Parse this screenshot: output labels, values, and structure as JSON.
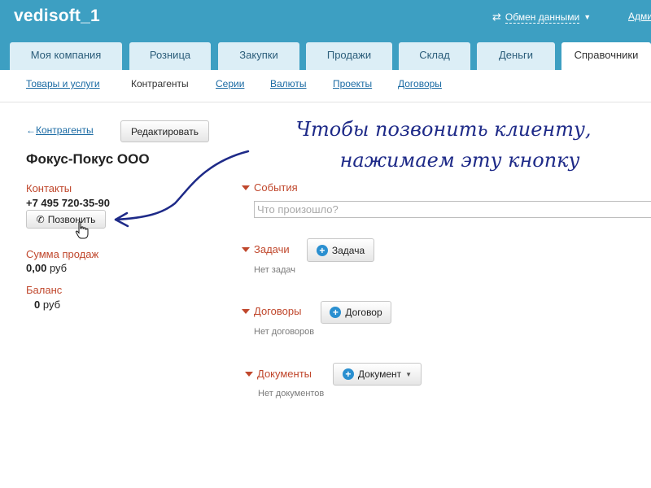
{
  "app": {
    "logo": "vedisoft_1",
    "exchange_label": "Обмен данными",
    "admin_label": "Адми"
  },
  "tabs": [
    {
      "label": "Моя компания"
    },
    {
      "label": "Розница"
    },
    {
      "label": "Закупки"
    },
    {
      "label": "Продажи"
    },
    {
      "label": "Склад"
    },
    {
      "label": "Деньги"
    },
    {
      "label": "Справочники",
      "active": true
    }
  ],
  "subnav": [
    {
      "label": "Товары и услуги"
    },
    {
      "label": "Контрагенты",
      "current": true
    },
    {
      "label": "Серии"
    },
    {
      "label": "Валюты"
    },
    {
      "label": "Проекты"
    },
    {
      "label": "Договоры"
    }
  ],
  "left": {
    "back_link": "Контрагенты",
    "back_arrow": "←",
    "edit_button": "Редактировать",
    "company_name": "Фокус-Покус ООО",
    "contacts_label": "Контакты",
    "phone": "+7 495 720-35-90",
    "call_button": "Позвонить",
    "sales_label": "Сумма продаж",
    "sales_value": "0,00",
    "sales_currency": "руб",
    "balance_label": "Баланс",
    "balance_value": "0",
    "balance_currency": "руб"
  },
  "right": {
    "events_title": "События",
    "events_placeholder": "Что произошло?",
    "tasks_title": "Задачи",
    "tasks_button": "Задача",
    "tasks_empty": "Нет задач",
    "contracts_title": "Договоры",
    "contracts_button": "Договор",
    "contracts_empty": "Нет договоров",
    "documents_title": "Документы",
    "documents_button": "Документ",
    "documents_empty": "Нет документов"
  },
  "annotation": {
    "line1": "Чтобы позвонить клиенту,",
    "line2": "нажимаем эту кнопку"
  },
  "colors": {
    "header": "#3d9fc2",
    "tab_inactive": "#dceef6",
    "link": "#1a6aa3",
    "section_red": "#c0472c",
    "annotation_ink": "#1e2a88"
  },
  "icons": [
    "exchange-arrows-icon",
    "caret-down-icon",
    "back-arrow-icon",
    "phone-icon",
    "hand-cursor-icon",
    "triangle-down-icon",
    "plus-circle-icon"
  ]
}
